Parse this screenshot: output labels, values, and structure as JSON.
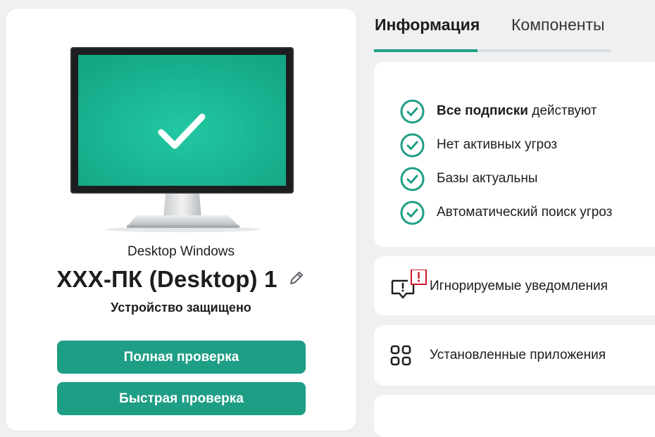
{
  "device": {
    "type": "Desktop Windows",
    "name": "XXX-ПК (Desktop) 1",
    "status": "Устройство защищено",
    "full_scan_label": "Полная проверка",
    "quick_scan_label": "Быстрая проверка"
  },
  "tabs": {
    "info": "Информация",
    "components": "Компоненты"
  },
  "status_items": [
    {
      "bold": "Все подписки",
      "text": " действуют"
    },
    {
      "bold": "",
      "text": "Нет активных угроз"
    },
    {
      "bold": "",
      "text": "Базы актуальны"
    },
    {
      "bold": "",
      "text": "Автоматический поиск угроз"
    }
  ],
  "ignored_notifications": "Игнорируемые уведомления",
  "installed_apps": "Установленные приложения",
  "colors": {
    "accent": "#1f9e86",
    "screen": "#21c4a0",
    "alert": "#d0182d"
  }
}
